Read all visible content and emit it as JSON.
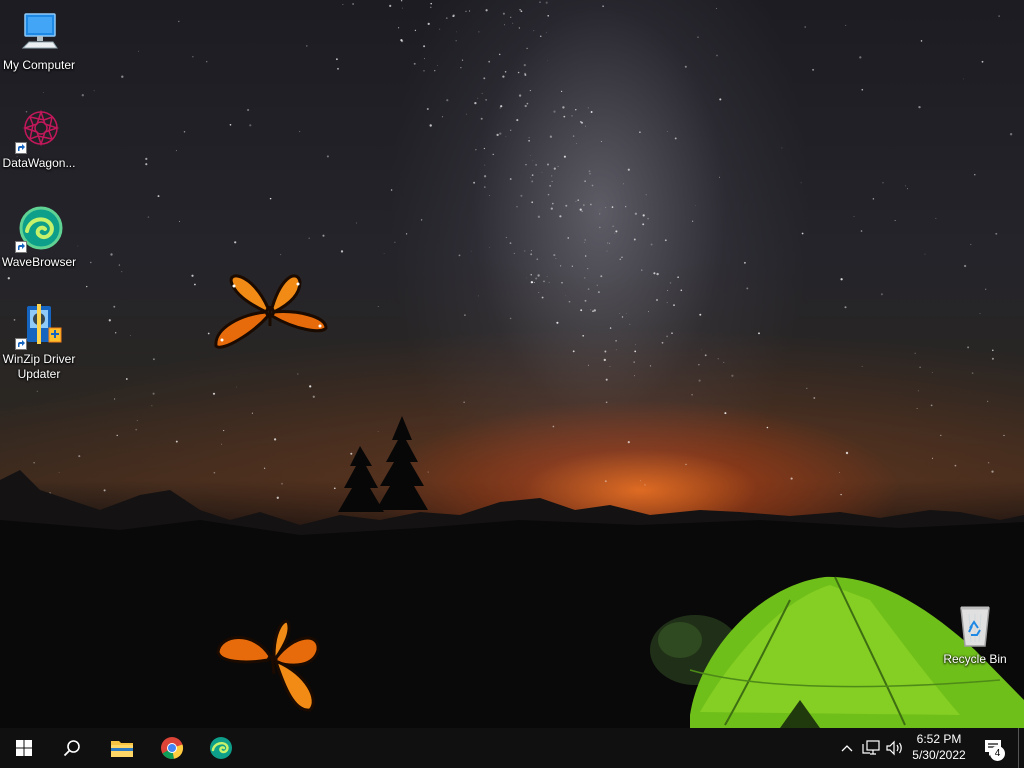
{
  "desktop": {
    "icons": [
      {
        "label": "My Computer",
        "icon": "computer-icon"
      },
      {
        "label": "DataWagon...",
        "icon": "datawagon-icon"
      },
      {
        "label": "WaveBrowser",
        "icon": "wavebrowser-icon"
      },
      {
        "label": "WinZip Driver Updater",
        "icon": "winzip-driver-updater-icon"
      },
      {
        "label": "Recycle Bin",
        "icon": "recycle-bin-icon"
      }
    ]
  },
  "taskbar": {
    "pinned": [
      {
        "name": "start",
        "icon": "windows-logo-icon"
      },
      {
        "name": "search",
        "icon": "search-icon"
      },
      {
        "name": "file-explorer",
        "icon": "folder-icon"
      },
      {
        "name": "chrome",
        "icon": "chrome-icon"
      },
      {
        "name": "wavebrowser",
        "icon": "wavebrowser-icon"
      }
    ],
    "tray": {
      "time": "6:52 PM",
      "date": "5/30/2022",
      "notification_count": "4"
    }
  }
}
